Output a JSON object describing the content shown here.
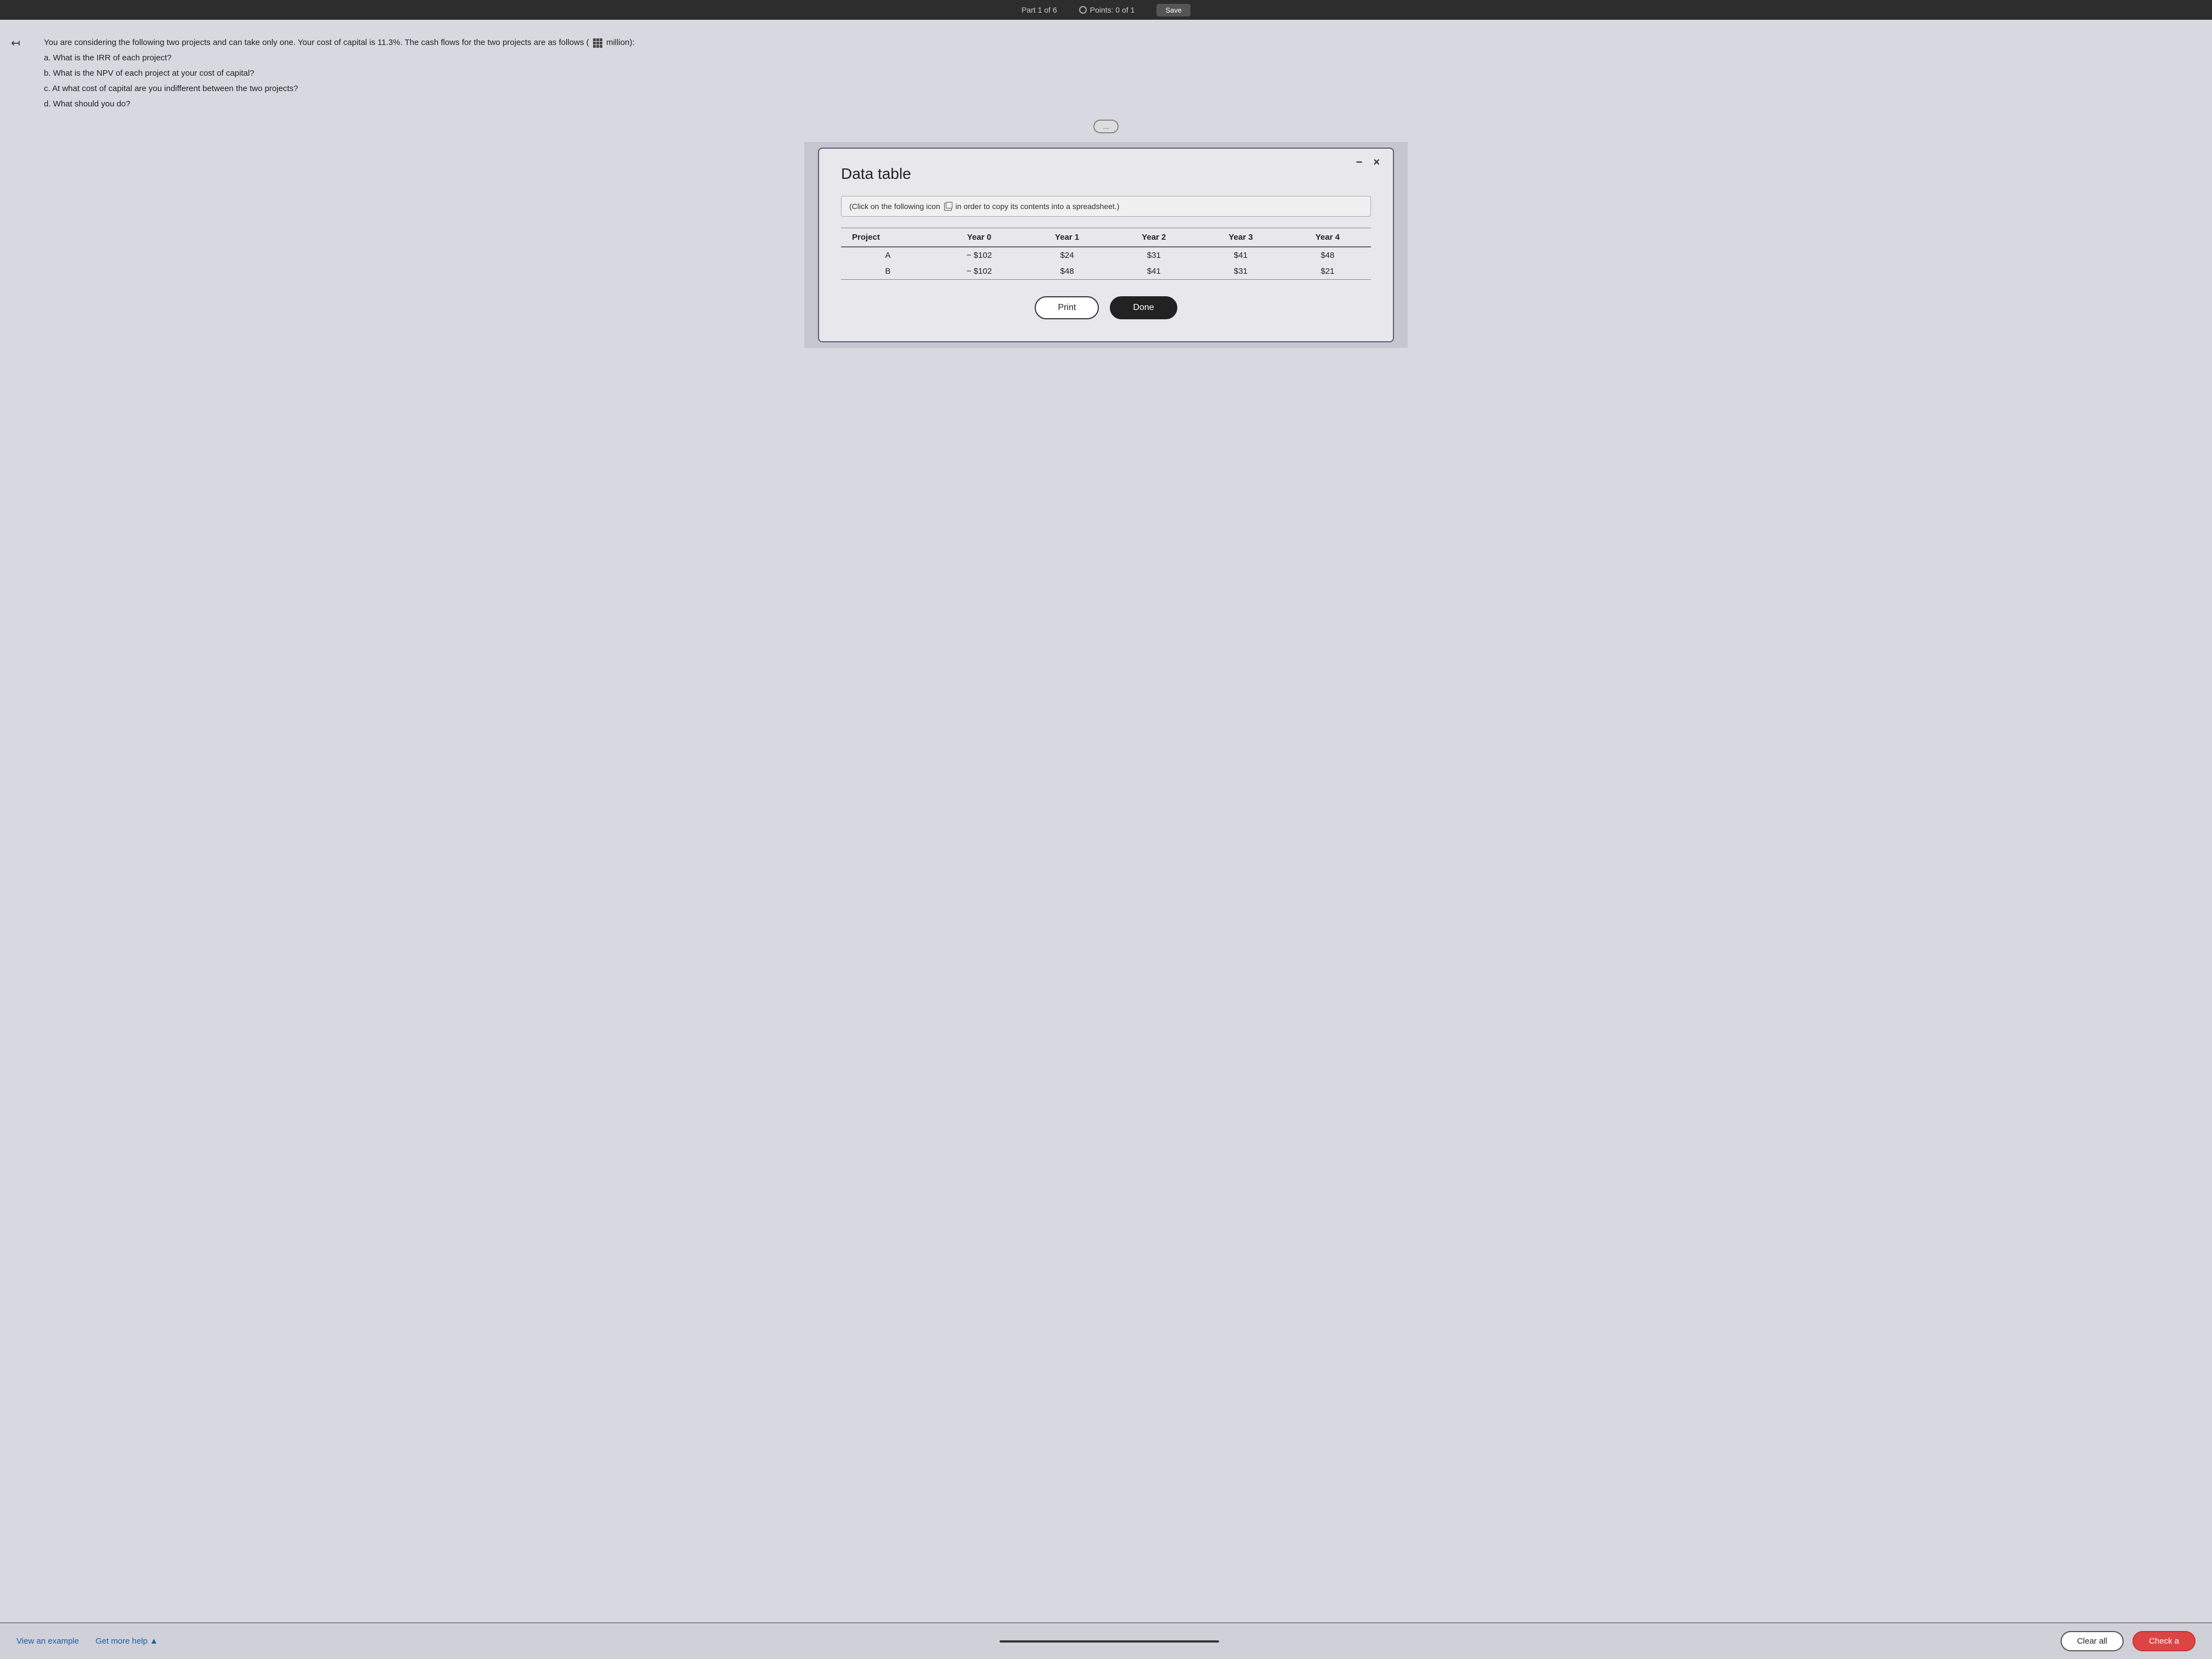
{
  "topBar": {
    "partLabel": "Part 1 of 6",
    "pointsLabel": "Points: 0 of 1",
    "saveLabel": "Save"
  },
  "question": {
    "intro": "You are considering the following two projects and can take only one. Your cost of capital is 11.3%. The cash flows for the two projects are as follows (",
    "introEnd": "million):",
    "parts": [
      "a. What is the IRR of each project?",
      "b. What is the NPV of each project at your cost of capital?",
      "c. At what cost of capital are you indifferent between the two projects?",
      "d. What should you do?"
    ],
    "moreBtn": "..."
  },
  "modal": {
    "title": "Data table",
    "instruction": "(Click on the following icon",
    "instructionEnd": "in order to copy its contents into a spreadsheet.)",
    "minBtn": "−",
    "closeBtn": "×",
    "table": {
      "headers": [
        "Project",
        "Year 0",
        "Year 1",
        "Year 2",
        "Year 3",
        "Year 4"
      ],
      "rows": [
        [
          "A",
          "− $102",
          "$24",
          "$31",
          "$41",
          "$48"
        ],
        [
          "B",
          "− $102",
          "$48",
          "$41",
          "$31",
          "$21"
        ]
      ]
    },
    "printBtn": "Print",
    "doneBtn": "Done"
  },
  "bottomBar": {
    "viewExample": "View an example",
    "getMoreHelp": "Get more help ▲",
    "clearAll": "Clear all",
    "checkAnswer": "Check a"
  }
}
